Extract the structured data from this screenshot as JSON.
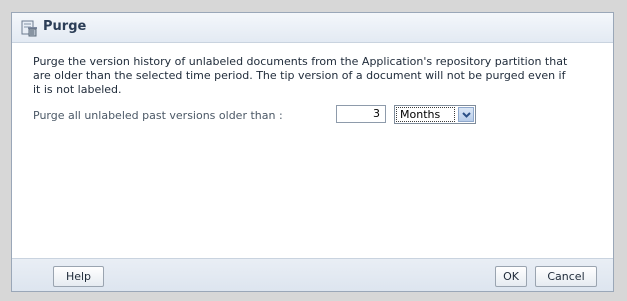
{
  "dialog": {
    "title": "Purge",
    "description": "Purge the version history of unlabeled documents from the Application's repository partition that are older than the selected time period. The tip version of a document will not be purged even if it is not labeled.",
    "purge_label": "Purge all unlabeled past versions older than :",
    "age_value": "3",
    "age_unit": "Months",
    "icons": {
      "title_icon": "trash-can-icon",
      "dropdown_icon": "chevron-down-icon"
    }
  },
  "footer": {
    "help_label": "Help",
    "ok_label": "OK",
    "cancel_label": "Cancel"
  },
  "colors": {
    "title_text": "#2c3e57",
    "dialog_border": "#9aa7b8",
    "footer_bg": "#e3eaf3"
  }
}
